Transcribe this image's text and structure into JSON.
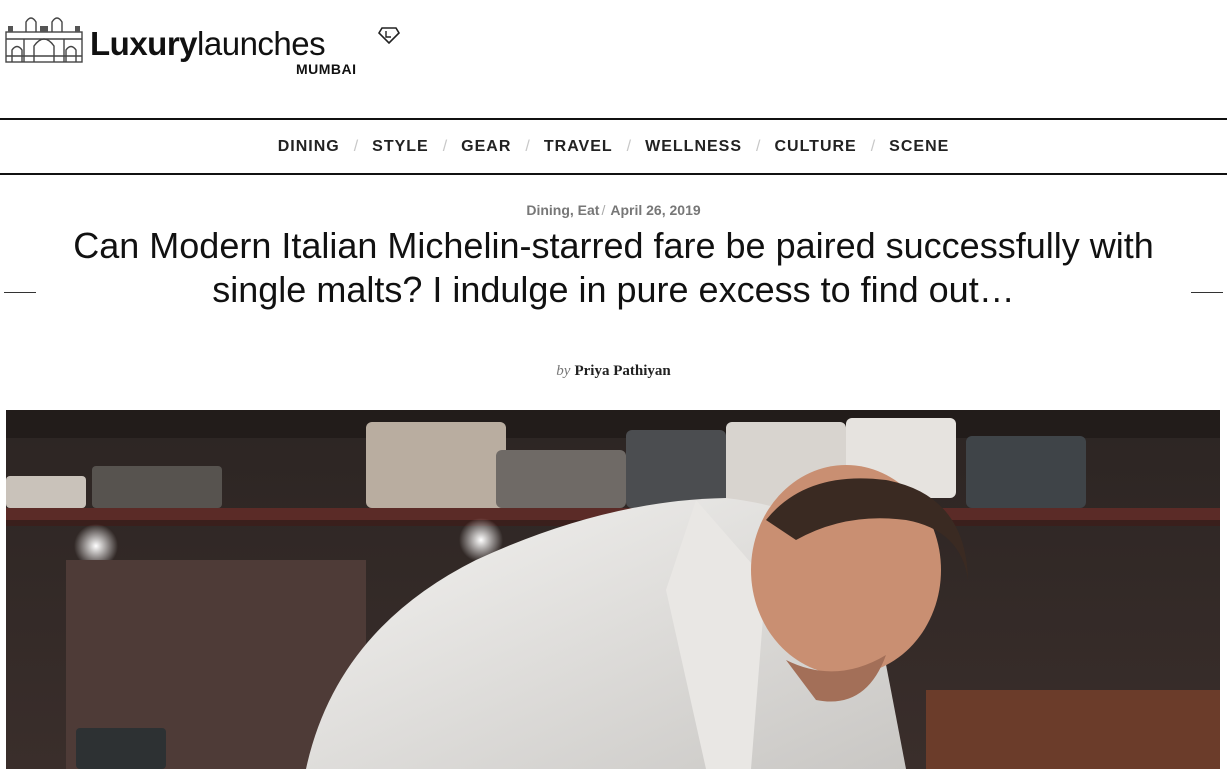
{
  "header": {
    "logo_bold": "Luxury",
    "logo_light": "launches",
    "logo_city": "MUMBAI"
  },
  "nav": {
    "items": [
      "DINING",
      "STYLE",
      "GEAR",
      "TRAVEL",
      "WELLNESS",
      "CULTURE",
      "SCENE"
    ],
    "separator": "/"
  },
  "article": {
    "categories": "Dining, Eat",
    "date": "April 26, 2019",
    "title": "Can Modern Italian Michelin-starred fare be paired successfully with single malts? I indulge in pure excess to find out…",
    "by_label": "by",
    "author": "Priya Pathiyan"
  },
  "icons": {
    "logo": "gateway-of-india-icon",
    "badge": "diamond-badge-icon"
  },
  "colors": {
    "text": "#111111",
    "meta": "#777777",
    "separator": "#c8c8c8",
    "rule": "#111111"
  }
}
